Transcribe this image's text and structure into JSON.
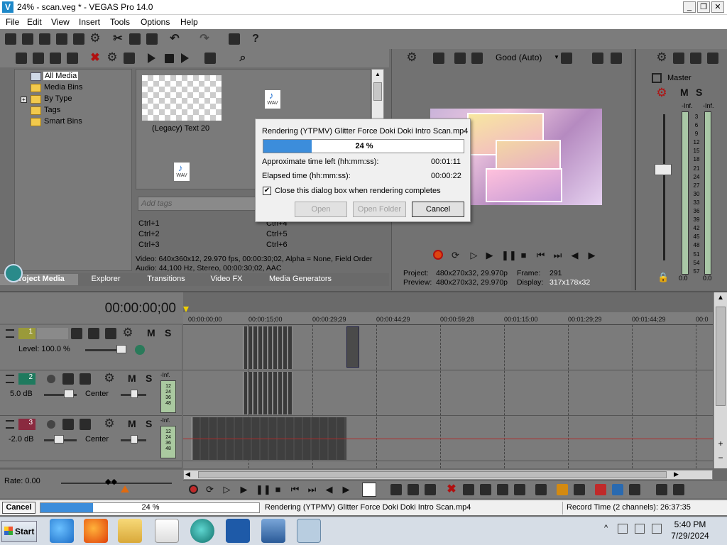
{
  "window": {
    "title": "24% - scan.veg * - VEGAS Pro 14.0",
    "min": "_",
    "max": "❐",
    "close": "✕"
  },
  "menu": [
    "File",
    "Edit",
    "View",
    "Insert",
    "Tools",
    "Options",
    "Help"
  ],
  "explorer_tree": {
    "items": [
      "All Media",
      "Media Bins",
      "By Type",
      "Tags",
      "Smart Bins"
    ]
  },
  "media": {
    "thumb1_label": "(Legacy) Text 20",
    "wav_label": "WAV",
    "tags_placeholder": "Add tags",
    "shortcuts_left": [
      "Ctrl+1",
      "Ctrl+2",
      "Ctrl+3"
    ],
    "shortcuts_right": [
      "Ctrl+4",
      "Ctrl+5",
      "Ctrl+6"
    ],
    "video_info": "Video: 640x360x12, 29.970 fps, 00:00:30;02, Alpha = None, Field Order",
    "audio_info": "Audio: 44,100 Hz, Stereo, 00:00:30;02, AAC"
  },
  "tabs": [
    "Project Media",
    "Explorer",
    "Transitions",
    "Video FX",
    "Media Generators"
  ],
  "preview": {
    "quality": "Good (Auto)",
    "project_label": "Project:",
    "project_value": "480x270x32, 29.970p",
    "preview_label": "Preview:",
    "preview_value": "480x270x32, 29.970p",
    "frame_label": "Frame:",
    "frame_value": "291",
    "display_label": "Display:",
    "display_value": "317x178x32"
  },
  "master": {
    "label": "Master",
    "inf_left": "-Inf.",
    "inf_right": "-Inf.",
    "scale": [
      "3",
      "6",
      "9",
      "12",
      "15",
      "18",
      "21",
      "24",
      "27",
      "30",
      "33",
      "36",
      "39",
      "42",
      "45",
      "48",
      "51",
      "54",
      "57"
    ],
    "out_left": "0.0",
    "out_right": "0.0"
  },
  "dialog": {
    "title": "Rendering (YTPMV) Glitter Force Doki Doki Intro Scan.mp4",
    "percent": "24 %",
    "progress": 0.24,
    "time_left_label": "Approximate time left (hh:mm:ss):",
    "time_left_value": "00:01:11",
    "elapsed_label": "Elapsed time (hh:mm:ss):",
    "elapsed_value": "00:00:22",
    "checkbox_label": "Close this dialog box when rendering completes",
    "btn_open": "Open",
    "btn_open_folder": "Open Folder",
    "btn_cancel": "Cancel"
  },
  "timeline": {
    "timecode": "00:00:00;00",
    "ruler": [
      "00:00:00;00",
      "00:00:15;00",
      "00:00:29;29",
      "00:00:44;29",
      "00:00:59;28",
      "00:01:15;00",
      "00:01:29;29",
      "00:01:44;29",
      "00:0"
    ],
    "tracks": [
      {
        "num": "1",
        "level_label": "Level: 100.0 %"
      },
      {
        "num": "2",
        "vol": "5.0 dB",
        "pan": "Center",
        "inf": "-Inf.",
        "meter": [
          "12",
          "24",
          "36",
          "48"
        ]
      },
      {
        "num": "3",
        "vol": "-2.0 dB",
        "pan": "Center",
        "inf": "-Inf.",
        "meter": [
          "12",
          "24",
          "36",
          "48"
        ]
      }
    ],
    "M": "M",
    "S": "S",
    "rate": "Rate: 0.00"
  },
  "status": {
    "cancel": "Cancel",
    "percent": "24 %",
    "progress": 0.24,
    "rendering": "Rendering (YTPMV) Glitter Force Doki Doki Intro Scan.mp4",
    "record_time": "Record Time (2 channels): 26:37:35"
  },
  "taskbar": {
    "start": "Start",
    "time": "5:40 PM",
    "date": "7/29/2024"
  },
  "colors": {
    "accent": "#1f6fd1",
    "progress": "#3c8ddb",
    "track2": "#1f7a5e",
    "track3": "#8a2a3f",
    "track1": "#9a9a3a"
  }
}
